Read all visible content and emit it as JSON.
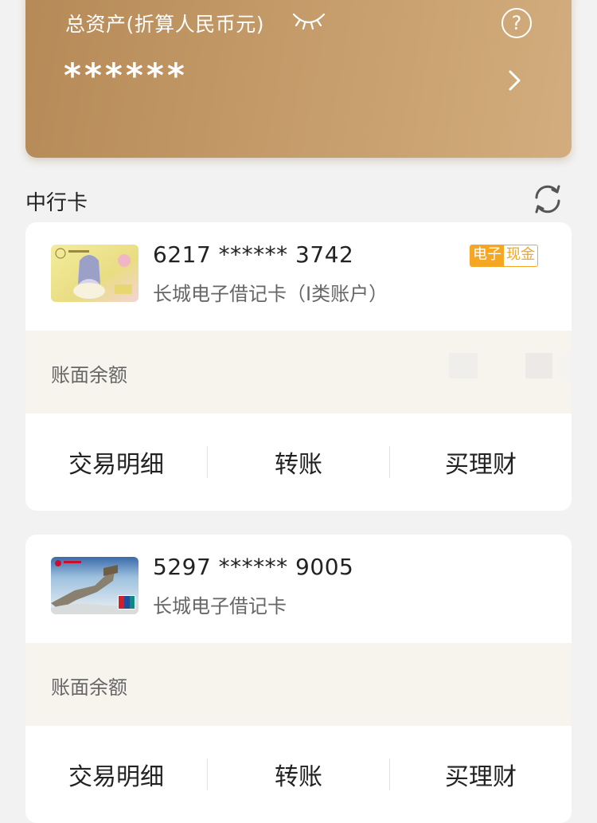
{
  "header": {
    "total_assets_label": "总资产(折算人民币元)",
    "total_assets_value": "******",
    "eye_icon": "eye-closed-icon",
    "help_icon": "question-circle-icon",
    "help_glyph": "?"
  },
  "section": {
    "title": "中行卡",
    "refresh_icon": "refresh-icon"
  },
  "cards": [
    {
      "number": "6217 ****** 3742",
      "type": "长城电子借记卡（I类账户）",
      "badge_left": "电子",
      "badge_right": "现金",
      "balance_label": "账面余额",
      "actions": [
        "交易明细",
        "转账",
        "买理财"
      ]
    },
    {
      "number": "5297 ****** 9005",
      "type": "长城电子借记卡",
      "balance_label": "账面余额",
      "actions": [
        "交易明细",
        "转账",
        "买理财"
      ]
    }
  ],
  "colors": {
    "gold_start": "#b68a57",
    "gold_end": "#d3ad7e",
    "badge_orange": "#f5a623",
    "balance_band": "#f7f4ee",
    "page_bg": "#f2f2f2"
  }
}
